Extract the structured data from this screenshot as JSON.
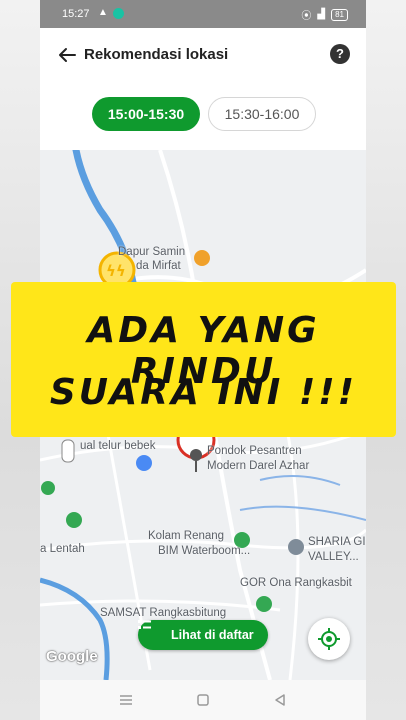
{
  "status_bar": {
    "time": "15:27",
    "battery": "81"
  },
  "header": {
    "title": "Rekomendasi lokasi",
    "help_label": "?"
  },
  "tabs": [
    {
      "label": "15:00-15:30",
      "active": true
    },
    {
      "label": "15:30-16:00",
      "active": false
    }
  ],
  "map": {
    "labels": {
      "dapur_line1": "Dapur Samin",
      "dapur_line2": "da Mirfat",
      "telur": "ual telur bebek",
      "pondok_line1": "Pondok Pesantren",
      "pondok_line2": "Modern Darel Azhar",
      "kolam_line1": "Kolam Renang",
      "kolam_line2": "BIM Waterboom...",
      "lentah": "a Lentah",
      "sharia_line1": "SHARIA GI",
      "sharia_line2": "VALLEY...",
      "gor": "GOR Ona Rangkasbit",
      "samsat": "SAMSAT Rangkasbitung"
    },
    "attribution": "Google"
  },
  "list_button": {
    "label": "Lihat di daftar"
  },
  "overlay_banner": {
    "line1": "ADA YANG RINDU",
    "line2": "SUARA INI !!!"
  },
  "colors": {
    "primary_green": "#0f9a2e",
    "banner_yellow": "#ffe619",
    "water_blue": "#5b9ee0"
  }
}
